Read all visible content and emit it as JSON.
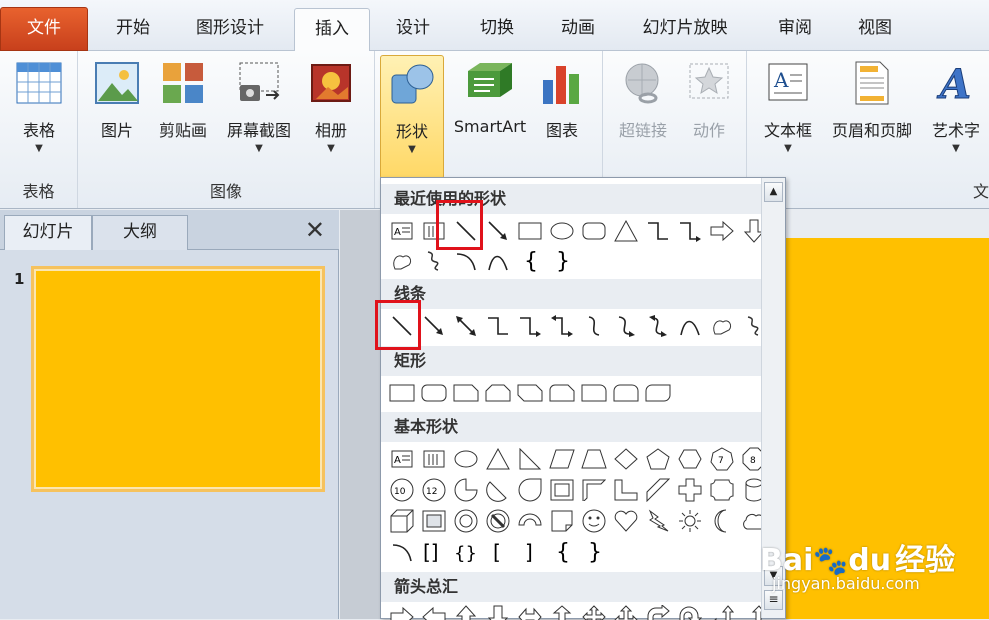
{
  "tabs": [
    "文件",
    "开始",
    "图形设计",
    "插入",
    "设计",
    "切换",
    "动画",
    "幻灯片放映",
    "审阅",
    "视图"
  ],
  "ribbon": {
    "table_btn": "表格",
    "table_group": "表格",
    "picture": "图片",
    "clipart": "剪贴画",
    "screenshot": "屏幕截图",
    "album": "相册",
    "image_group": "图像",
    "shapes": "形状",
    "smartart": "SmartArt",
    "chart": "图表",
    "hyperlink": "超链接",
    "action": "动作",
    "textbox": "文本框",
    "header_footer": "页眉和页脚",
    "wordart": "艺术字",
    "text_group_partial": "文"
  },
  "panel": {
    "tab_slides": "幻灯片",
    "tab_outline": "大纲",
    "close": "✕",
    "slide_number": "1"
  },
  "shapes_menu": {
    "recent": "最近使用的形状",
    "lines": "线条",
    "rectangles": "矩形",
    "basic": "基本形状",
    "block_arrows": "箭头总汇"
  },
  "watermark": {
    "brand": "Bai",
    "brand2": "du",
    "jingyan": "经验",
    "url": "jingyan.baidu.com"
  },
  "colors": {
    "slide": "#ffc000",
    "file_tab": "#d84f22",
    "highlight": "#e0121b"
  }
}
